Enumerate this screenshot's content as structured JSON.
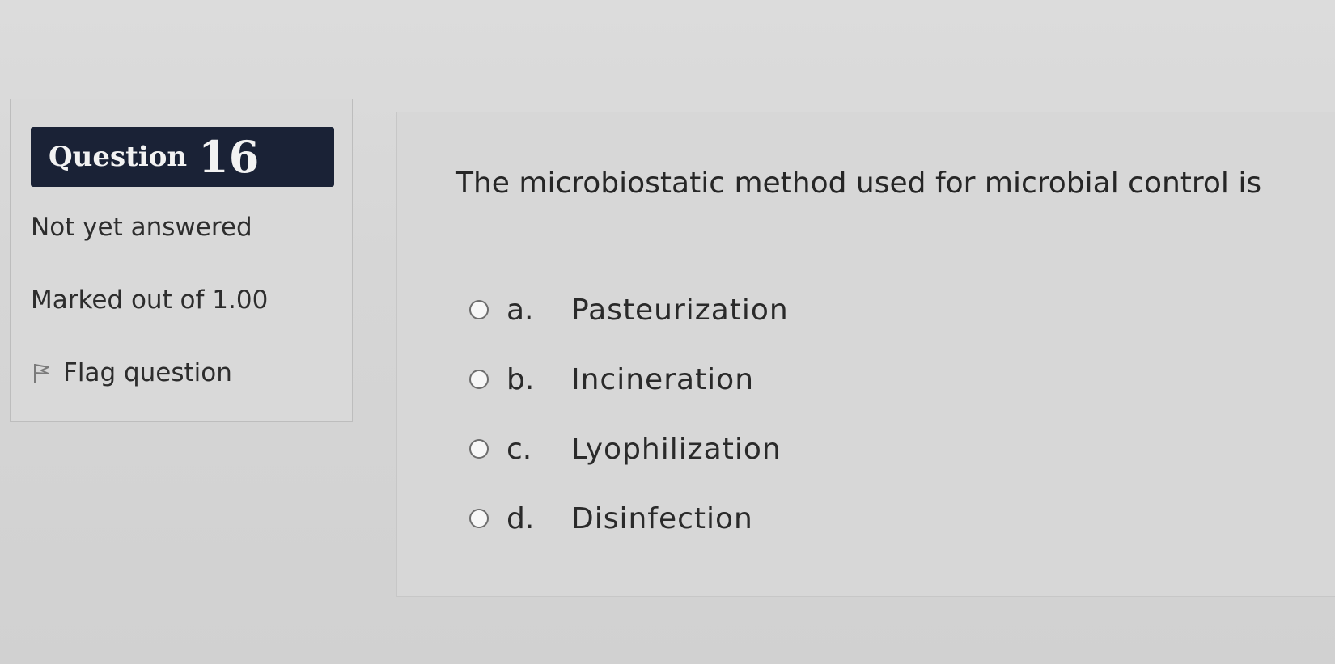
{
  "question_info": {
    "question_label": "Question",
    "question_number": "16",
    "state": "Not yet answered",
    "grade": "Marked out of 1.00",
    "flag_label": "Flag question",
    "flag_icon": "flag-icon"
  },
  "question": {
    "text": "The microbiostatic method used for microbial control is",
    "answers": [
      {
        "letter": "a.",
        "text": "Pasteurization",
        "selected": false
      },
      {
        "letter": "b.",
        "text": "Incineration",
        "selected": false
      },
      {
        "letter": "c.",
        "text": "Lyophilization",
        "selected": false
      },
      {
        "letter": "d.",
        "text": "Disinfection",
        "selected": false
      }
    ]
  },
  "colors": {
    "badge_background": "#1a2236",
    "badge_text": "#f2f2f2",
    "page_background": "#d6d6d6"
  }
}
